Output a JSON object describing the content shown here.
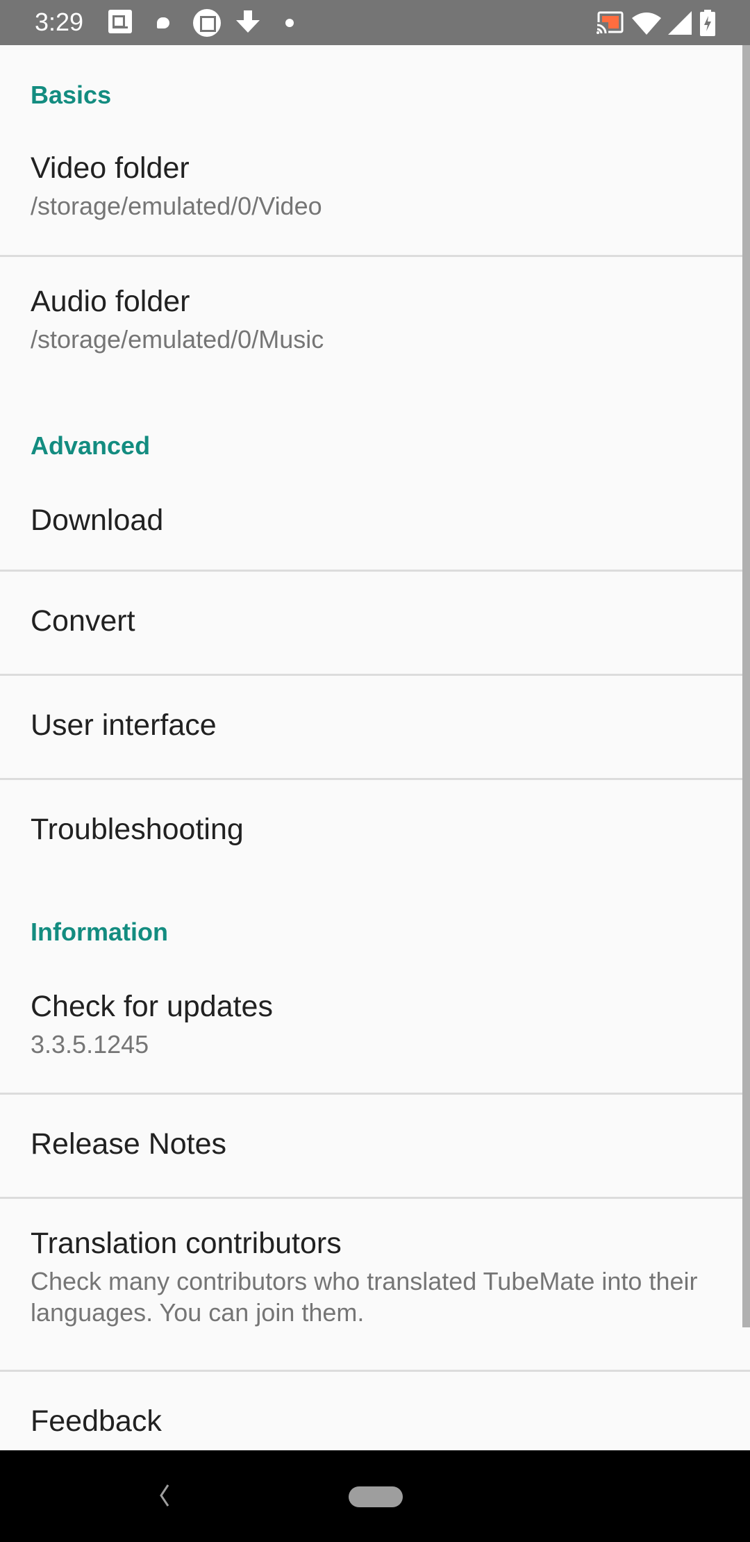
{
  "status_bar": {
    "time": "3:29",
    "icons": [
      "news-icon",
      "chat-bubble-icon",
      "screenshot-edit-icon",
      "download-icon",
      "notification-dot-icon",
      "cast-icon",
      "wifi-icon",
      "cell-signal-icon",
      "battery-charging-icon"
    ],
    "cast_color": "#ff6d3f"
  },
  "settings": {
    "accent_color": "#138c80",
    "sections": [
      {
        "header": "Basics",
        "items": [
          {
            "title": "Video folder",
            "summary": "/storage/emulated/0/Video"
          },
          {
            "title": "Audio folder",
            "summary": "/storage/emulated/0/Music"
          }
        ]
      },
      {
        "header": "Advanced",
        "items": [
          {
            "title": "Download"
          },
          {
            "title": "Convert"
          },
          {
            "title": "User interface"
          },
          {
            "title": "Troubleshooting"
          }
        ]
      },
      {
        "header": "Information",
        "items": [
          {
            "title": "Check for updates",
            "summary": "3.3.5.1245"
          },
          {
            "title": "Release Notes"
          },
          {
            "title": "Translation contributors",
            "summary": "Check many contributors who translated TubeMate into their languages. You can join them."
          },
          {
            "title": "Feedback"
          }
        ]
      }
    ]
  },
  "nav_bar": {
    "icons": [
      "back-icon",
      "home-pill-icon"
    ]
  }
}
